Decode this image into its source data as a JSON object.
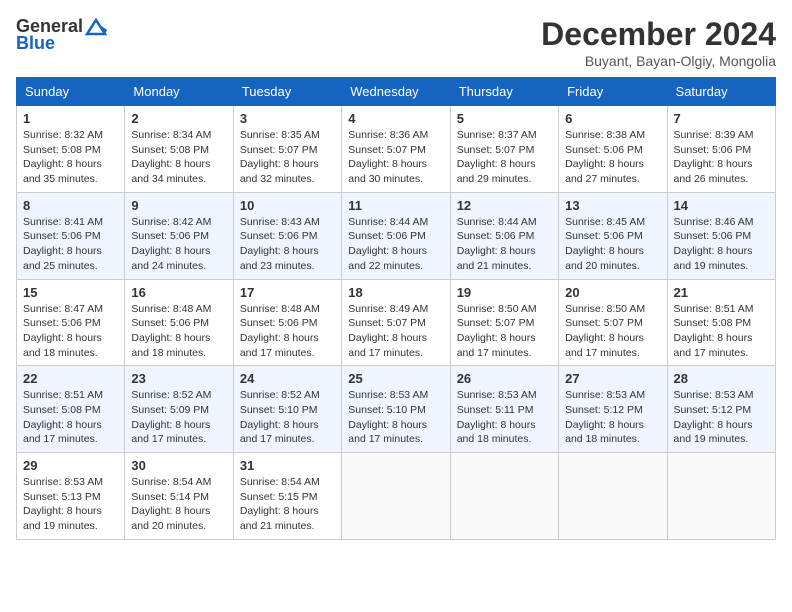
{
  "header": {
    "logo_general": "General",
    "logo_blue": "Blue",
    "month": "December 2024",
    "location": "Buyant, Bayan-Olgiy, Mongolia"
  },
  "days_of_week": [
    "Sunday",
    "Monday",
    "Tuesday",
    "Wednesday",
    "Thursday",
    "Friday",
    "Saturday"
  ],
  "weeks": [
    [
      {
        "day": "1",
        "sunrise": "Sunrise: 8:32 AM",
        "sunset": "Sunset: 5:08 PM",
        "daylight": "Daylight: 8 hours and 35 minutes."
      },
      {
        "day": "2",
        "sunrise": "Sunrise: 8:34 AM",
        "sunset": "Sunset: 5:08 PM",
        "daylight": "Daylight: 8 hours and 34 minutes."
      },
      {
        "day": "3",
        "sunrise": "Sunrise: 8:35 AM",
        "sunset": "Sunset: 5:07 PM",
        "daylight": "Daylight: 8 hours and 32 minutes."
      },
      {
        "day": "4",
        "sunrise": "Sunrise: 8:36 AM",
        "sunset": "Sunset: 5:07 PM",
        "daylight": "Daylight: 8 hours and 30 minutes."
      },
      {
        "day": "5",
        "sunrise": "Sunrise: 8:37 AM",
        "sunset": "Sunset: 5:07 PM",
        "daylight": "Daylight: 8 hours and 29 minutes."
      },
      {
        "day": "6",
        "sunrise": "Sunrise: 8:38 AM",
        "sunset": "Sunset: 5:06 PM",
        "daylight": "Daylight: 8 hours and 27 minutes."
      },
      {
        "day": "7",
        "sunrise": "Sunrise: 8:39 AM",
        "sunset": "Sunset: 5:06 PM",
        "daylight": "Daylight: 8 hours and 26 minutes."
      }
    ],
    [
      {
        "day": "8",
        "sunrise": "Sunrise: 8:41 AM",
        "sunset": "Sunset: 5:06 PM",
        "daylight": "Daylight: 8 hours and 25 minutes."
      },
      {
        "day": "9",
        "sunrise": "Sunrise: 8:42 AM",
        "sunset": "Sunset: 5:06 PM",
        "daylight": "Daylight: 8 hours and 24 minutes."
      },
      {
        "day": "10",
        "sunrise": "Sunrise: 8:43 AM",
        "sunset": "Sunset: 5:06 PM",
        "daylight": "Daylight: 8 hours and 23 minutes."
      },
      {
        "day": "11",
        "sunrise": "Sunrise: 8:44 AM",
        "sunset": "Sunset: 5:06 PM",
        "daylight": "Daylight: 8 hours and 22 minutes."
      },
      {
        "day": "12",
        "sunrise": "Sunrise: 8:44 AM",
        "sunset": "Sunset: 5:06 PM",
        "daylight": "Daylight: 8 hours and 21 minutes."
      },
      {
        "day": "13",
        "sunrise": "Sunrise: 8:45 AM",
        "sunset": "Sunset: 5:06 PM",
        "daylight": "Daylight: 8 hours and 20 minutes."
      },
      {
        "day": "14",
        "sunrise": "Sunrise: 8:46 AM",
        "sunset": "Sunset: 5:06 PM",
        "daylight": "Daylight: 8 hours and 19 minutes."
      }
    ],
    [
      {
        "day": "15",
        "sunrise": "Sunrise: 8:47 AM",
        "sunset": "Sunset: 5:06 PM",
        "daylight": "Daylight: 8 hours and 18 minutes."
      },
      {
        "day": "16",
        "sunrise": "Sunrise: 8:48 AM",
        "sunset": "Sunset: 5:06 PM",
        "daylight": "Daylight: 8 hours and 18 minutes."
      },
      {
        "day": "17",
        "sunrise": "Sunrise: 8:48 AM",
        "sunset": "Sunset: 5:06 PM",
        "daylight": "Daylight: 8 hours and 17 minutes."
      },
      {
        "day": "18",
        "sunrise": "Sunrise: 8:49 AM",
        "sunset": "Sunset: 5:07 PM",
        "daylight": "Daylight: 8 hours and 17 minutes."
      },
      {
        "day": "19",
        "sunrise": "Sunrise: 8:50 AM",
        "sunset": "Sunset: 5:07 PM",
        "daylight": "Daylight: 8 hours and 17 minutes."
      },
      {
        "day": "20",
        "sunrise": "Sunrise: 8:50 AM",
        "sunset": "Sunset: 5:07 PM",
        "daylight": "Daylight: 8 hours and 17 minutes."
      },
      {
        "day": "21",
        "sunrise": "Sunrise: 8:51 AM",
        "sunset": "Sunset: 5:08 PM",
        "daylight": "Daylight: 8 hours and 17 minutes."
      }
    ],
    [
      {
        "day": "22",
        "sunrise": "Sunrise: 8:51 AM",
        "sunset": "Sunset: 5:08 PM",
        "daylight": "Daylight: 8 hours and 17 minutes."
      },
      {
        "day": "23",
        "sunrise": "Sunrise: 8:52 AM",
        "sunset": "Sunset: 5:09 PM",
        "daylight": "Daylight: 8 hours and 17 minutes."
      },
      {
        "day": "24",
        "sunrise": "Sunrise: 8:52 AM",
        "sunset": "Sunset: 5:10 PM",
        "daylight": "Daylight: 8 hours and 17 minutes."
      },
      {
        "day": "25",
        "sunrise": "Sunrise: 8:53 AM",
        "sunset": "Sunset: 5:10 PM",
        "daylight": "Daylight: 8 hours and 17 minutes."
      },
      {
        "day": "26",
        "sunrise": "Sunrise: 8:53 AM",
        "sunset": "Sunset: 5:11 PM",
        "daylight": "Daylight: 8 hours and 18 minutes."
      },
      {
        "day": "27",
        "sunrise": "Sunrise: 8:53 AM",
        "sunset": "Sunset: 5:12 PM",
        "daylight": "Daylight: 8 hours and 18 minutes."
      },
      {
        "day": "28",
        "sunrise": "Sunrise: 8:53 AM",
        "sunset": "Sunset: 5:12 PM",
        "daylight": "Daylight: 8 hours and 19 minutes."
      }
    ],
    [
      {
        "day": "29",
        "sunrise": "Sunrise: 8:53 AM",
        "sunset": "Sunset: 5:13 PM",
        "daylight": "Daylight: 8 hours and 19 minutes."
      },
      {
        "day": "30",
        "sunrise": "Sunrise: 8:54 AM",
        "sunset": "Sunset: 5:14 PM",
        "daylight": "Daylight: 8 hours and 20 minutes."
      },
      {
        "day": "31",
        "sunrise": "Sunrise: 8:54 AM",
        "sunset": "Sunset: 5:15 PM",
        "daylight": "Daylight: 8 hours and 21 minutes."
      },
      null,
      null,
      null,
      null
    ]
  ]
}
